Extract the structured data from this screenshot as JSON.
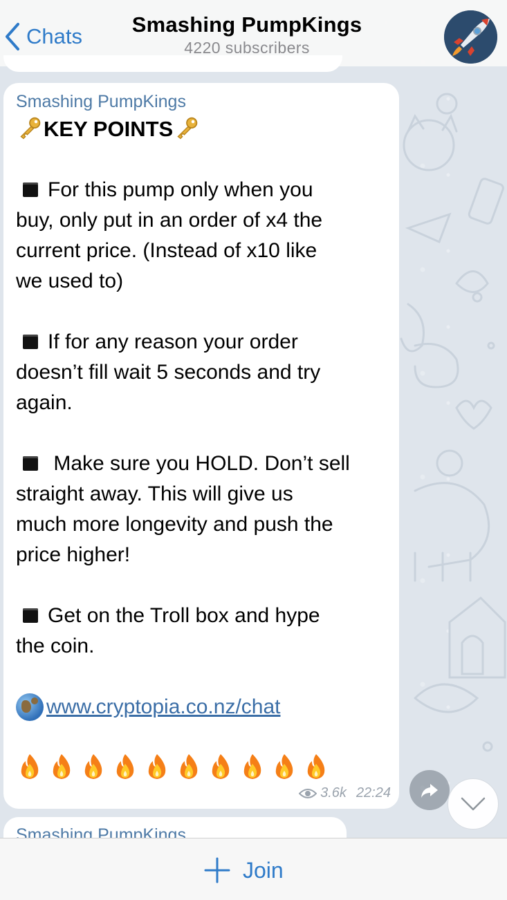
{
  "header": {
    "back_label": "Chats",
    "title": "Smashing PumpKings",
    "subtitle": "4220 subscribers",
    "avatar_icon": "rocket-icon"
  },
  "message": {
    "sender": "Smashing PumpKings",
    "heading": "KEY POINTS",
    "heading_emoji": "key-icon",
    "bullet_icon": "black-square-icon",
    "points": [
      [
        "For this pump only when you",
        "buy, only put in an order of x4 the",
        "current price.  (Instead of x10 like",
        "we used to)"
      ],
      [
        "If for any reason your order",
        "doesn’t fill wait 5 seconds and try",
        "again."
      ],
      [
        " Make sure you HOLD. Don’t sell",
        "straight away. This will give us",
        "much more longevity and push the",
        "price higher!"
      ],
      [
        "Get on the Troll box and hype",
        "the coin."
      ]
    ],
    "link": "www.cryptopia.co.nz/chat",
    "link_icon": "globe-icon",
    "fire_emoji_count": 10,
    "fire_icon": "fire-icon",
    "views": "3.6k",
    "time": "22:24"
  },
  "next_message": {
    "sender": "Smashing PumpKings"
  },
  "bottom": {
    "join_label": "Join"
  },
  "colors": {
    "accent": "#2f7bc9",
    "sender": "#4e7aa6",
    "link": "#3a6da6"
  }
}
